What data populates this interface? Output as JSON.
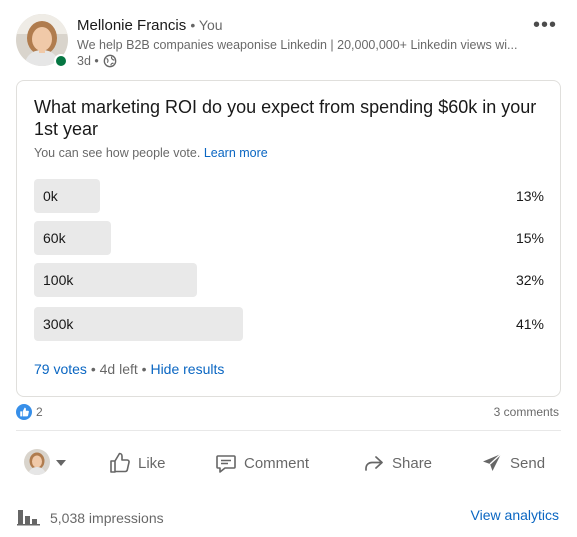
{
  "author": {
    "name": "Mellonie Francis",
    "relation": "• You",
    "headline": "We help B2B companies weaponise Linkedin | 20,000,000+ Linkedin views wi...",
    "time": "3d •"
  },
  "poll": {
    "question": "What marketing ROI do you expect from spending $60k in your 1st year",
    "note": "You can see how people vote.",
    "learn_more": "Learn more",
    "options": [
      {
        "label": "0k",
        "percent": 13,
        "percent_text": "13%"
      },
      {
        "label": "60k",
        "percent": 15,
        "percent_text": "15%"
      },
      {
        "label": "100k",
        "percent": 32,
        "percent_text": "32%"
      },
      {
        "label": "300k",
        "percent": 41,
        "percent_text": "41%"
      }
    ],
    "votes": "79 votes",
    "time_left": "• 4d left •",
    "hide_results": "Hide results"
  },
  "social": {
    "reaction_count": "2",
    "comments": "3 comments"
  },
  "actions": {
    "like": "Like",
    "comment": "Comment",
    "share": "Share",
    "send": "Send"
  },
  "footer": {
    "impressions": "5,038 impressions",
    "analytics": "View analytics"
  },
  "colors": {
    "link": "#0a66c2",
    "bar": "#e9e9e9",
    "presence": "#057642",
    "like_badge": "#378fe9"
  }
}
